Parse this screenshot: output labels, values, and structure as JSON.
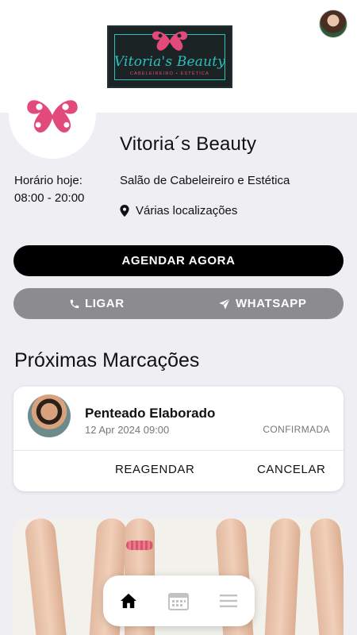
{
  "header": {
    "brand_logo_text": "Vitoria's Beauty",
    "brand_logo_tagline": "CABELEIREIRO • ESTÉTICA",
    "user_avatar_icon": "user-avatar"
  },
  "salon": {
    "name": "Vitoria´s Beauty",
    "hours_label": "Horário hoje:",
    "hours_value": "08:00 - 20:00",
    "category": "Salão de Cabeleireiro e Estética",
    "location": "Várias localizações",
    "location_icon": "map-pin-icon"
  },
  "actions": {
    "book_now": "AGENDAR AGORA",
    "call": "LIGAR",
    "call_icon": "phone-icon",
    "whatsapp": "WHATSAPP",
    "whatsapp_icon": "send-icon"
  },
  "appointments": {
    "section_title": "Próximas Marcações",
    "items": [
      {
        "service": "Penteado Elaborado",
        "datetime": "12 Apr 2024 09:00",
        "status": "CONFIRMADA",
        "reschedule_label": "REAGENDAR",
        "cancel_label": "CANCELAR"
      }
    ]
  },
  "bottom_nav": {
    "items": [
      {
        "icon": "home-icon",
        "active": true
      },
      {
        "icon": "calendar-icon",
        "active": false
      },
      {
        "icon": "menu-icon",
        "active": false
      }
    ]
  },
  "colors": {
    "brand_pink": "#e14a7a",
    "brand_teal": "#2bc0c0",
    "primary_button": "#000000",
    "secondary_button": "#8c8c90",
    "background": "#efeef3"
  }
}
